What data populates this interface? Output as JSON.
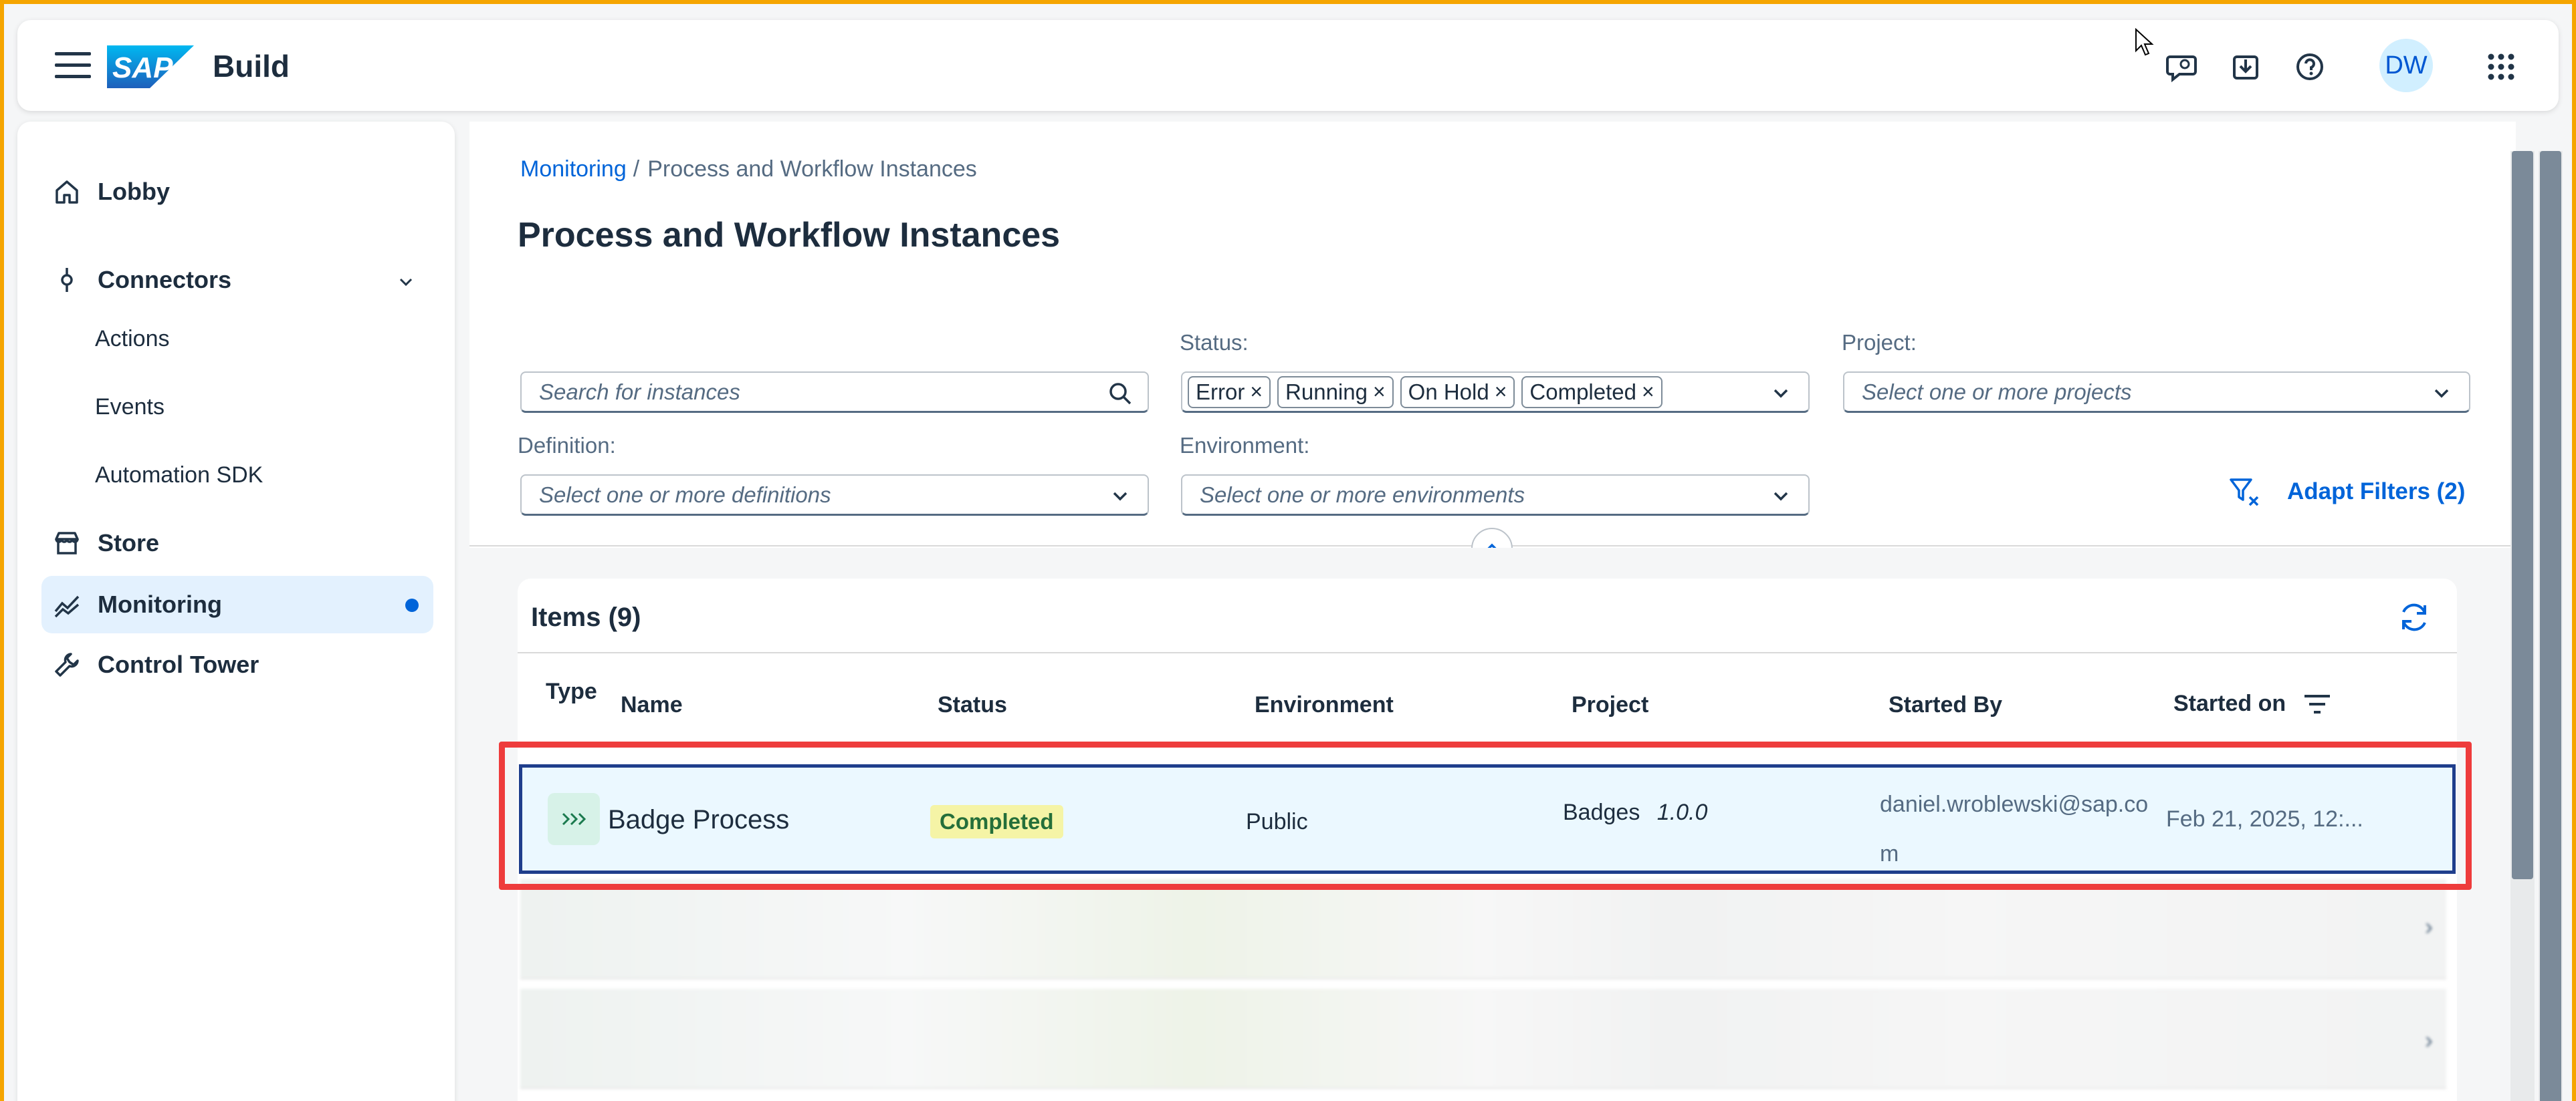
{
  "shell": {
    "product": "Build",
    "logo_text": "SAP",
    "avatar_initials": "DW"
  },
  "sidenav": {
    "items": [
      {
        "label": "Lobby"
      },
      {
        "label": "Connectors"
      },
      {
        "label": "Actions"
      },
      {
        "label": "Events"
      },
      {
        "label": "Automation SDK"
      },
      {
        "label": "Store"
      },
      {
        "label": "Monitoring"
      },
      {
        "label": "Control Tower"
      }
    ]
  },
  "breadcrumb": {
    "link": "Monitoring",
    "separator": "/",
    "current": "Process and Workflow Instances"
  },
  "page": {
    "title": "Process and Workflow Instances"
  },
  "filters": {
    "search_placeholder": "Search for instances",
    "status_label": "Status:",
    "status_tokens": [
      "Error",
      "Running",
      "On Hold",
      "Completed"
    ],
    "project_label": "Project:",
    "project_placeholder": "Select one or more projects",
    "definition_label": "Definition:",
    "definition_placeholder": "Select one or more definitions",
    "environment_label": "Environment:",
    "environment_placeholder": "Select one or more environments",
    "adapt_label": "Adapt Filters (2)"
  },
  "table": {
    "title": "Items (9)",
    "columns": [
      "Type",
      "Name",
      "Status",
      "Environment",
      "Project",
      "Started By",
      "Started on"
    ],
    "rows": [
      {
        "name": "Badge Process",
        "status": "Completed",
        "environment": "Public",
        "project": "Badges",
        "version": "1.0.0",
        "started_by_line1": "daniel.wroblewski@sap.co",
        "started_by_line2": "m",
        "started_on": "Feb 21, 2025, 12:..."
      }
    ]
  },
  "colors": {
    "accent": "#0064d9",
    "highlight": "#ee3c3c",
    "selected_row_border": "#1f3e8c",
    "frame": "#f5a500"
  }
}
